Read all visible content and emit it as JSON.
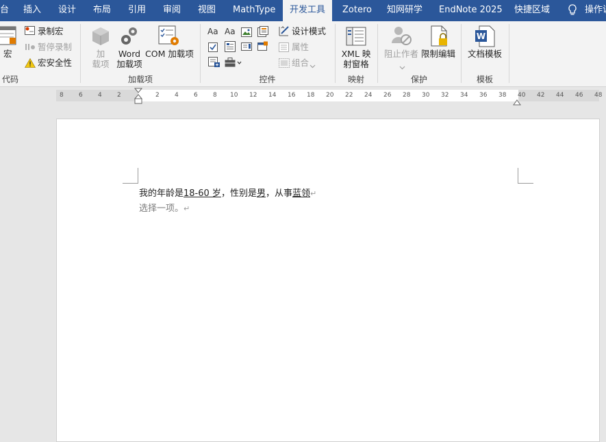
{
  "tabs": [
    "台",
    "插入",
    "设计",
    "布局",
    "引用",
    "审阅",
    "视图",
    "MathType",
    "开发工具",
    "Zotero",
    "知网研学",
    "EndNote 2025",
    "快捷区域",
    "操作说"
  ],
  "active_tab": "开发工具",
  "tell_me_icon": "lightbulb-icon",
  "ribbon": {
    "code": {
      "macro_label": "宏",
      "record_macro": "录制宏",
      "pause_recording": "暂停录制",
      "macro_security": "宏安全性",
      "group_label": "代码"
    },
    "addins": {
      "addins_label": "加\n载项",
      "word_addins": "Word\n加载项",
      "com_addins": "COM 加载项",
      "group_label": "加载项"
    },
    "controls": {
      "design_mode": "设计模式",
      "properties": "属性",
      "group": "组合",
      "group_label": "控件"
    },
    "mapping": {
      "xml_pane": "XML 映\n射窗格",
      "group_label": "映射"
    },
    "protect": {
      "block_authors": "阻止作者",
      "restrict_editing": "限制编辑",
      "group_label": "保护"
    },
    "templates": {
      "doc_template": "文档模板",
      "group_label": "模板"
    }
  },
  "ruler": {
    "ticks": [
      "8",
      "6",
      "4",
      "2",
      "2",
      "4",
      "6",
      "8",
      "10",
      "12",
      "14",
      "16",
      "18",
      "20",
      "22",
      "24",
      "26",
      "28",
      "30",
      "32",
      "34",
      "36",
      "38",
      "40",
      "42",
      "44",
      "46",
      "48"
    ]
  },
  "document": {
    "line1_part1": "我的年龄是",
    "age_field": "18-60 岁",
    "line1_part2": "，性别是",
    "gender_field": "男",
    "line1_part3": "，从事",
    "occupation_field": "蓝领",
    "paragraph_mark": "↵",
    "line2": "选择一项。",
    "line2_mark": "↵"
  },
  "colors": {
    "tabbar": "#2b579a",
    "ribbon": "#f3f3f3",
    "page_bg": "#e6e6e6"
  }
}
